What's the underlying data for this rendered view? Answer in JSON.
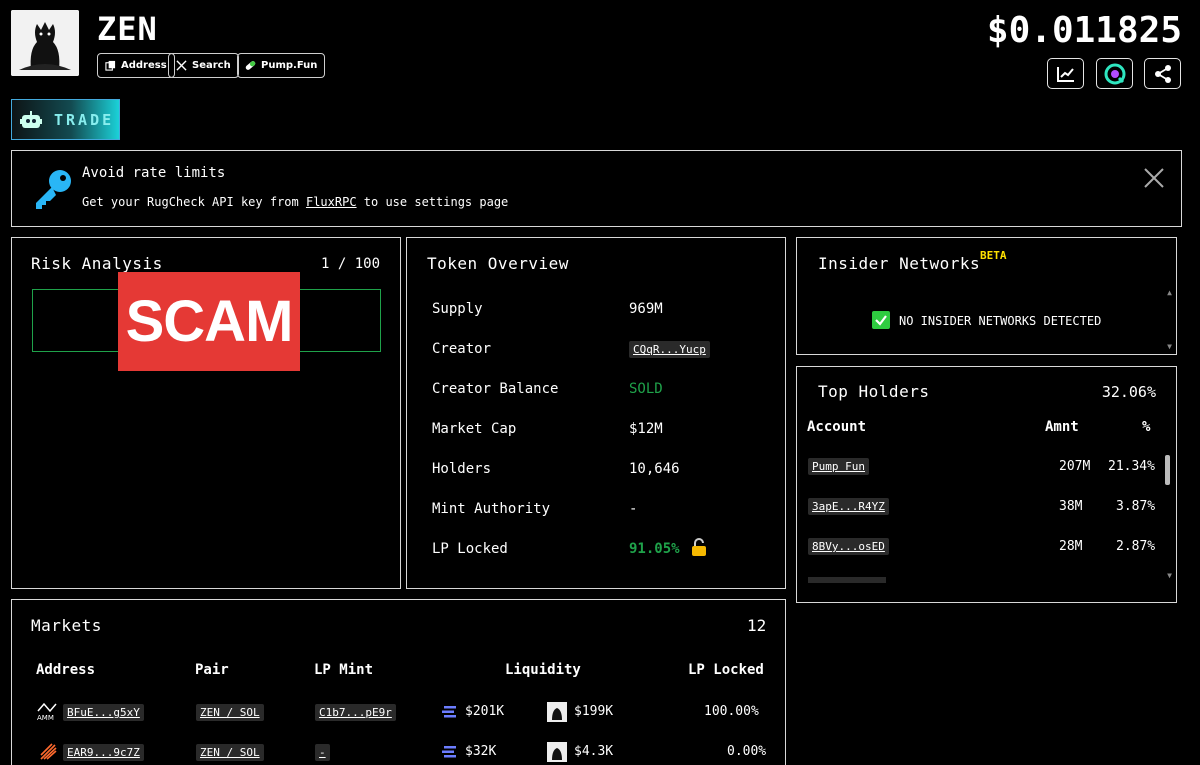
{
  "token": {
    "name": "ZEN",
    "price": "$0.011825"
  },
  "chips": [
    {
      "label": "Address",
      "icon": "copy-icon"
    },
    {
      "label": "Search",
      "icon": "x-icon"
    },
    {
      "label": "Pump.Fun",
      "icon": "pill-icon"
    }
  ],
  "header_icons": [
    "chart-icon",
    "coingecko-icon",
    "share-icon"
  ],
  "trade": {
    "label": "TRADE"
  },
  "banner": {
    "title": "Avoid rate limits",
    "desc_before": "Get your RugCheck API key from ",
    "desc_link": "FluxRPC",
    "desc_after": " to use settings page"
  },
  "risk": {
    "title": "Risk Analysis",
    "score": "1 / 100",
    "verdict": "SCAM"
  },
  "overview": {
    "title": "Token Overview",
    "rows": [
      {
        "label": "Supply",
        "value": "969M"
      },
      {
        "label": "Creator",
        "value": "CQqR...Yucp"
      },
      {
        "label": "Creator Balance",
        "value": "SOLD"
      },
      {
        "label": "Market Cap",
        "value": "$12M"
      },
      {
        "label": "Holders",
        "value": "10,646"
      },
      {
        "label": "Mint Authority",
        "value": "-"
      },
      {
        "label": "LP Locked",
        "value": "91.05%"
      }
    ]
  },
  "insider": {
    "title": "Insider Networks",
    "badge": "BETA",
    "status": "NO INSIDER NETWORKS DETECTED"
  },
  "holders": {
    "title": "Top Holders",
    "total": "32.06%",
    "columns": [
      "Account",
      "Amnt",
      "%"
    ],
    "rows": [
      {
        "account": "Pump Fun",
        "amount": "207M",
        "pct": "21.34%"
      },
      {
        "account": "3apE...R4YZ",
        "amount": "38M",
        "pct": "3.87%"
      },
      {
        "account": "8BVy...osED",
        "amount": "28M",
        "pct": "2.87%"
      }
    ]
  },
  "markets": {
    "title": "Markets",
    "count": "12",
    "columns": [
      "Address",
      "Pair",
      "LP Mint",
      "Liquidity",
      "LP Locked"
    ],
    "rows": [
      {
        "address": "BFuE...g5xY",
        "pair": "ZEN / SOL",
        "lp_mint": "C1b7...pE9r",
        "liq_a": "$201K",
        "liq_b": "$199K",
        "lp_locked": "100.00%"
      },
      {
        "address": "EAR9...9c7Z",
        "pair": "ZEN / SOL",
        "lp_mint": "-",
        "liq_a": "$32K",
        "liq_b": "$4.3K",
        "lp_locked": "0.00%"
      }
    ]
  },
  "colors": {
    "accent_cyan": "#1bd1d8",
    "scam_red": "#e53935",
    "risk_green": "#1fa24a",
    "beta_yellow": "#ffe100"
  }
}
